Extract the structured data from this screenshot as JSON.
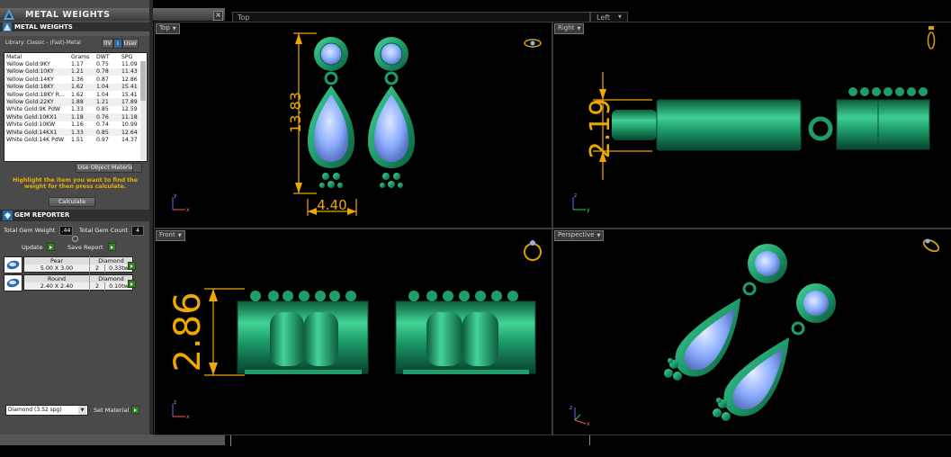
{
  "metal_panel": {
    "window_title": "METAL WEIGHTS",
    "section_title": "METAL WEIGHTS",
    "library_label": "Library: Classic - (Fast)-Metal",
    "units_value": "0V",
    "user_label": "User",
    "columns": [
      "Metal",
      "Grams",
      "DWT",
      "SPG"
    ],
    "rows": [
      [
        "Yellow Gold:9KY",
        "1.17",
        "0.75",
        "11.09"
      ],
      [
        "Yellow Gold:10KY",
        "1.21",
        "0.78",
        "11.43"
      ],
      [
        "Yellow Gold:14KY",
        "1.36",
        "0.87",
        "12.86"
      ],
      [
        "Yellow Gold:18KY",
        "1.62",
        "1.04",
        "15.41"
      ],
      [
        "Yellow Gold:18KY R...",
        "1.62",
        "1.04",
        "15.41"
      ],
      [
        "Yellow Gold:22KY",
        "1.88",
        "1.21",
        "17.89"
      ],
      [
        "White Gold:9K PdW",
        "1.33",
        "0.85",
        "12.59"
      ],
      [
        "White Gold:10KX1",
        "1.18",
        "0.76",
        "11.18"
      ],
      [
        "White Gold:10KW",
        "1.16",
        "0.74",
        "10.99"
      ],
      [
        "White Gold:14KX1",
        "1.33",
        "0.85",
        "12.64"
      ],
      [
        "White Gold:14K PdW",
        "1.51",
        "0.97",
        "14.37"
      ]
    ],
    "use_object_materials": "Use Object Materials",
    "hint": "Highlight the item you want to find the weight for then press calculate.",
    "calculate_label": "Calculate"
  },
  "gem_panel": {
    "section_title": "GEM REPORTER",
    "total_gem_weight_label": "Total Gem Weight",
    "total_gem_weight_value": ".44",
    "total_gem_count_label": "Total Gem Count",
    "total_gem_count_value": "4",
    "update_label": "Update",
    "save_report_label": "Save Report",
    "gems": [
      {
        "shape": "Pear",
        "material": "Diamond",
        "size": "5.00 X 3.00",
        "count": "2",
        "weight": "0.33tw"
      },
      {
        "shape": "Round",
        "material": "Diamond",
        "size": "2.40 X 2.40",
        "count": "2",
        "weight": "0.10tw"
      }
    ],
    "material_select": "Diamond   (3.52 spg)",
    "set_material_label": "Set Material"
  },
  "viewports": {
    "top": {
      "label": "Top",
      "dim_height": "13.83",
      "dim_width": "4.40"
    },
    "right": {
      "label": "Right",
      "dim_height": "2.19"
    },
    "front": {
      "label": "Front",
      "dim_height": "2.86"
    },
    "perspective": {
      "label": "Perspective"
    },
    "background_tabs": [
      "Top",
      "Left"
    ]
  },
  "colors": {
    "metal": "#1e9d6a",
    "gem": "#8fb0ff",
    "dimension": "#f0a800",
    "hint_text": "#e8b000"
  }
}
